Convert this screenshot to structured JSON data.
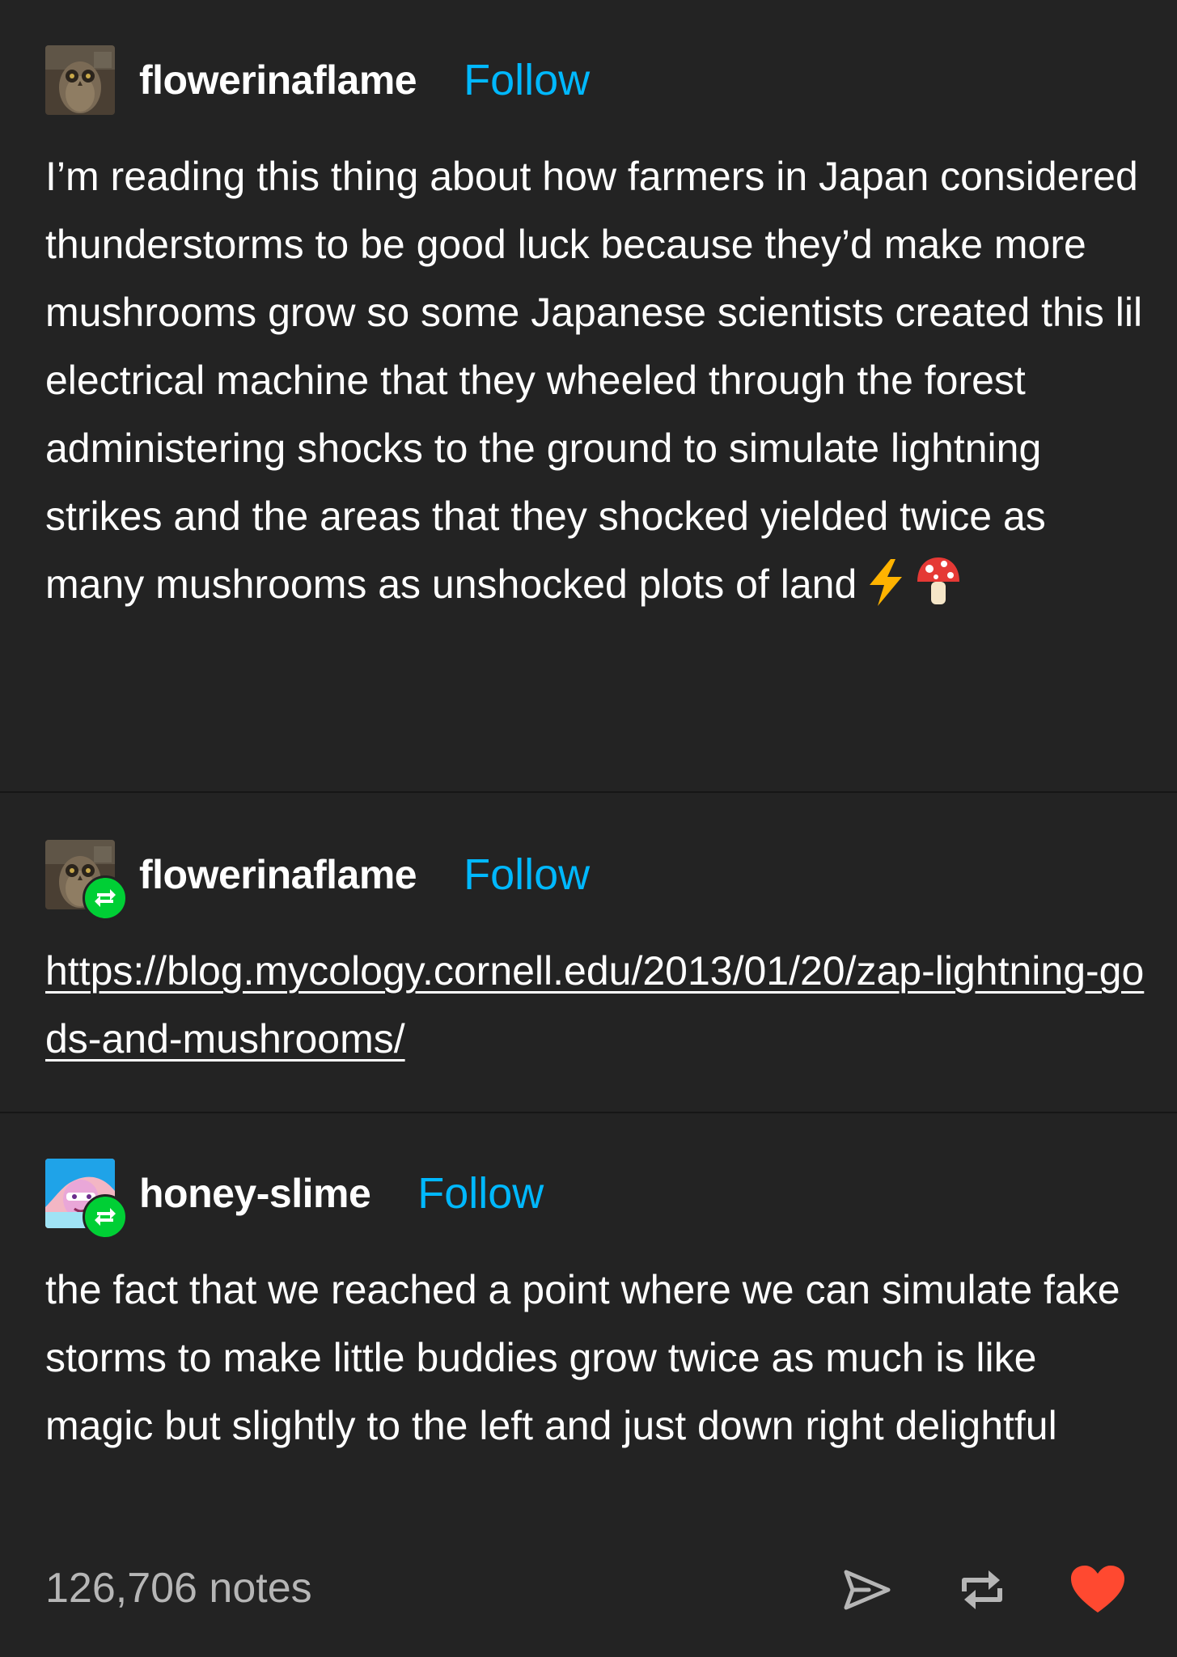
{
  "post": {
    "original": {
      "username": "flowerinaflame",
      "follow_label": "Follow",
      "text": "I’m reading this thing about how farmers in Japan considered thunderstorms to be good luck because they’d make more mushrooms grow so some Japanese scientists created this lil electrical machine that they wheeled through the forest administering shocks to the ground to simulate lightning strikes and the areas that they shocked yielded twice as many mushrooms as unshocked plots of land",
      "emojis": [
        "lightning-bolt",
        "mushroom"
      ]
    },
    "reblog_1": {
      "username": "flowerinaflame",
      "follow_label": "Follow",
      "link_text": "https://blog.mycology.cornell.edu/2013/01/20/zap-lightning-gods-and-mushrooms/"
    },
    "reblog_2": {
      "username": "honey-slime",
      "follow_label": "Follow",
      "text": "the fact that we reached a point where we can simulate fake storms to make little buddies grow twice as much is like magic but slightly to the left and just down right delightful"
    },
    "footer": {
      "notes": "126,706 notes",
      "icons": [
        "share-icon",
        "reblog-icon",
        "like-icon"
      ]
    }
  },
  "colors": {
    "background": "#232323",
    "follow": "#00b8ff",
    "reblog_badge": "#00cf35",
    "like": "#ff4930",
    "notes": "#b6b6b6"
  }
}
